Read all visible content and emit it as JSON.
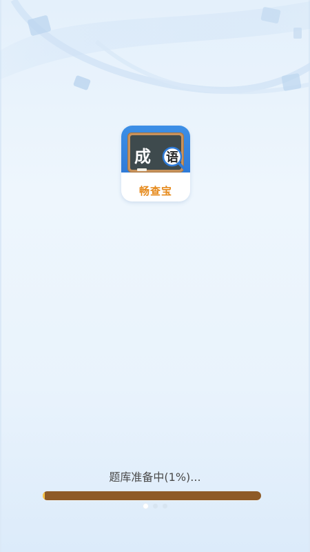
{
  "app": {
    "icon_char_1": "成",
    "icon_char_2": "语",
    "name": "畅查宝"
  },
  "loading": {
    "text": "题库准备中(1%)...",
    "progress_percent": 1
  },
  "pager": {
    "count": 3,
    "active_index": 0
  },
  "colors": {
    "icon_blue": "#2f7bd8",
    "app_name_orange": "#e68a1c",
    "progress_track": "#8e5b27",
    "progress_fill": "#f6c54a"
  }
}
